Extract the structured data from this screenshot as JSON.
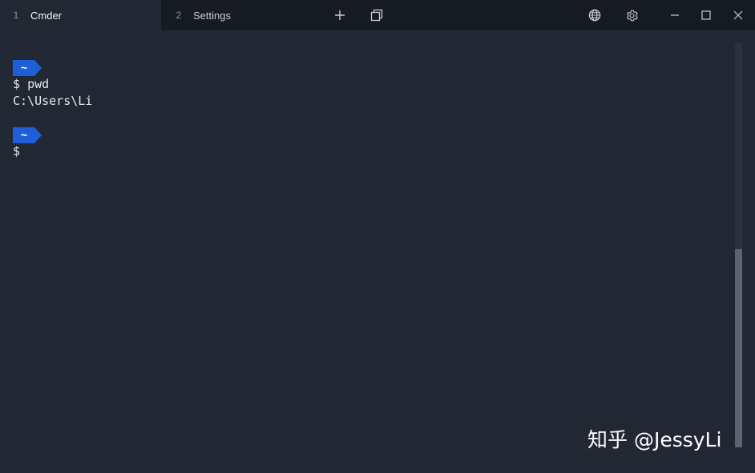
{
  "tabs": [
    {
      "number": "1",
      "label": "Cmder",
      "active": true
    },
    {
      "number": "2",
      "label": "Settings",
      "active": false
    }
  ],
  "titlebar": {
    "icons": [
      "plus-icon",
      "duplicate-window-icon",
      "globe-icon",
      "gear-icon",
      "minimize-icon",
      "maximize-icon",
      "close-icon"
    ]
  },
  "terminal": {
    "prompt_dir": "~",
    "prompt_symbol": "$",
    "lines": [
      {
        "type": "command",
        "text": "pwd"
      },
      {
        "type": "output",
        "text": "C:\\Users\\Li"
      }
    ]
  },
  "watermark": "知乎 @JessyLi",
  "colors": {
    "titlebar_bg": "#161b22",
    "terminal_bg": "#222833",
    "prompt_badge": "#1e5fd8",
    "text": "#e6e9ee"
  }
}
